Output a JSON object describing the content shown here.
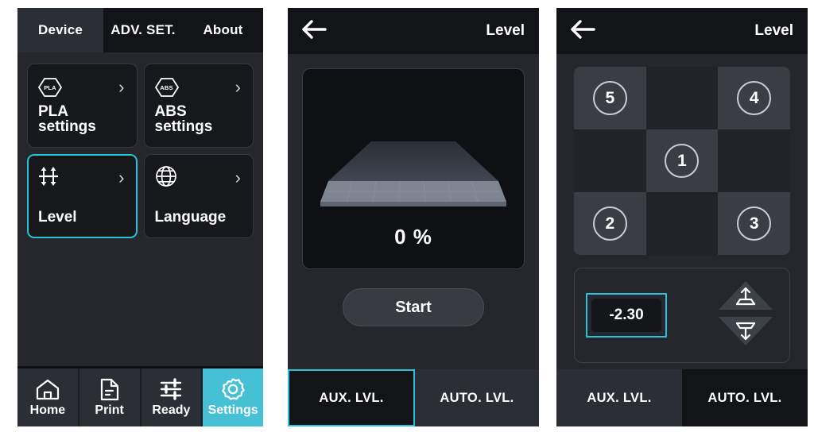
{
  "accent": "#29c3d9",
  "nav_active_bg": "#45c0d4",
  "device_panel": {
    "tabs": [
      {
        "label": "Device",
        "active": true
      },
      {
        "label": "ADV. SET.",
        "active": false
      },
      {
        "label": "About",
        "active": false
      }
    ],
    "cards": [
      {
        "label": "PLA settings",
        "icon": "hexagon-pla-icon",
        "icon_text": "PLA",
        "selected": false
      },
      {
        "label": "ABS settings",
        "icon": "hexagon-abs-icon",
        "icon_text": "ABS",
        "selected": false
      },
      {
        "label": "Level",
        "icon": "level-arrows-icon",
        "icon_text": "",
        "selected": true
      },
      {
        "label": "Language",
        "icon": "globe-icon",
        "icon_text": "",
        "selected": false
      }
    ],
    "chevron": "›",
    "bottom_nav": [
      {
        "label": "Home",
        "icon": "home-icon",
        "active": false
      },
      {
        "label": "Print",
        "icon": "document-icon",
        "active": false
      },
      {
        "label": "Ready",
        "icon": "sliders-icon",
        "active": false
      },
      {
        "label": "Settings",
        "icon": "gear-icon",
        "active": true
      }
    ]
  },
  "aux_panel": {
    "header": {
      "back_icon": "back-arrow-icon",
      "title": "Level"
    },
    "progress": "0 %",
    "start_label": "Start",
    "tabs": [
      {
        "label": "AUX. LVL.",
        "state": "selected"
      },
      {
        "label": "AUTO. LVL.",
        "state": "normal"
      }
    ]
  },
  "auto_panel": {
    "header": {
      "back_icon": "back-arrow-icon",
      "title": "Level"
    },
    "mesh": [
      {
        "num": "5",
        "on": true
      },
      {
        "num": "",
        "on": false
      },
      {
        "num": "4",
        "on": true
      },
      {
        "num": "",
        "on": false
      },
      {
        "num": "1",
        "on": true
      },
      {
        "num": "",
        "on": false
      },
      {
        "num": "2",
        "on": true
      },
      {
        "num": "",
        "on": false
      },
      {
        "num": "3",
        "on": true
      }
    ],
    "z_value": "-2.30",
    "up_icon": "nozzle-up-icon",
    "down_icon": "nozzle-down-icon",
    "tabs": [
      {
        "label": "AUX. LVL.",
        "state": "normal"
      },
      {
        "label": "AUTO. LVL.",
        "state": "active"
      }
    ]
  }
}
